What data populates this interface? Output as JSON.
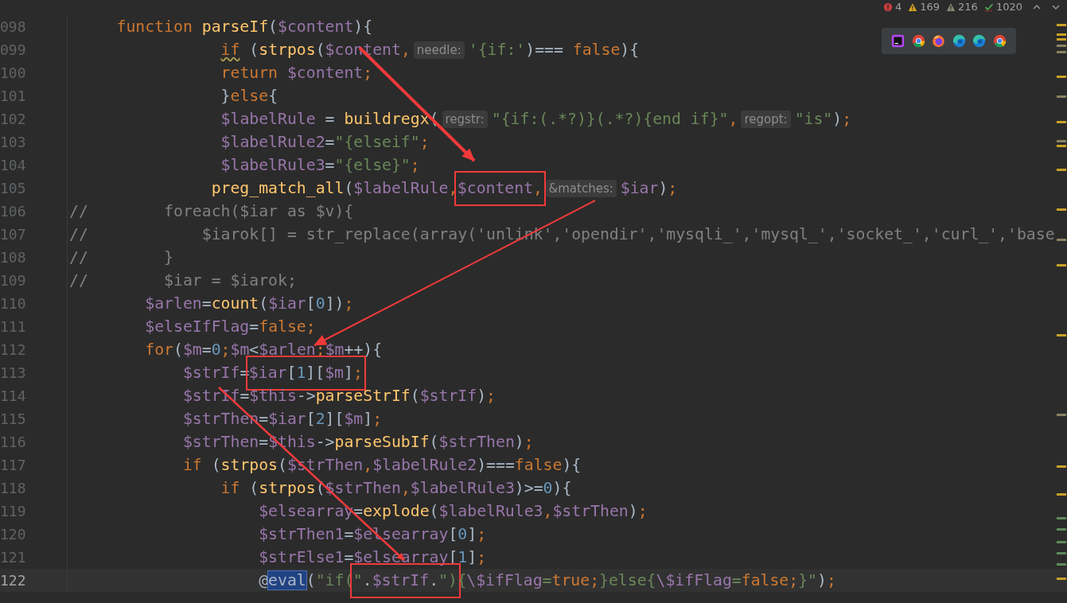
{
  "inspections": [
    {
      "kind": "error",
      "count": "4"
    },
    {
      "kind": "warning",
      "count": "169"
    },
    {
      "kind": "weak",
      "count": "216"
    },
    {
      "kind": "typo",
      "count": "1020"
    }
  ],
  "browsers": [
    {
      "kind": "ide"
    },
    {
      "kind": "chrome"
    },
    {
      "kind": "firefox"
    },
    {
      "kind": "edge"
    },
    {
      "kind": "edge"
    },
    {
      "kind": "chrome"
    }
  ],
  "lines": [
    {
      "number": "098",
      "current": false,
      "tokens": [
        {
          "kind": "k",
          "text": "     function "
        },
        {
          "kind": "f",
          "text": "parseIf"
        },
        {
          "kind": "t",
          "text": "("
        },
        {
          "kind": "v",
          "text": "$content"
        },
        {
          "kind": "t",
          "text": "){"
        }
      ]
    },
    {
      "number": "099",
      "current": false,
      "tokens": [
        {
          "kind": "w",
          "text": "                if"
        },
        {
          "kind": "t",
          "text": " ("
        },
        {
          "kind": "f",
          "text": "strpos"
        },
        {
          "kind": "t",
          "text": "("
        },
        {
          "kind": "v",
          "text": "$content"
        },
        {
          "kind": "k",
          "text": ","
        },
        {
          "kind": "h",
          "text": "needle:"
        },
        {
          "kind": "s",
          "text": "'{if:'"
        },
        {
          "kind": "t",
          "text": ")=== "
        },
        {
          "kind": "k",
          "text": "false"
        },
        {
          "kind": "t",
          "text": "){"
        }
      ]
    },
    {
      "number": "100",
      "current": false,
      "tokens": [
        {
          "kind": "k",
          "text": "                return "
        },
        {
          "kind": "v",
          "text": "$content"
        },
        {
          "kind": "k",
          "text": ";"
        }
      ]
    },
    {
      "number": "101",
      "current": false,
      "tokens": [
        {
          "kind": "t",
          "text": "                }"
        },
        {
          "kind": "k",
          "text": "else"
        },
        {
          "kind": "t",
          "text": "{"
        }
      ]
    },
    {
      "number": "102",
      "current": false,
      "tokens": [
        {
          "kind": "v",
          "text": "                $labelRule"
        },
        {
          "kind": "t",
          "text": " = "
        },
        {
          "kind": "f",
          "text": "buildregx"
        },
        {
          "kind": "t",
          "text": "("
        },
        {
          "kind": "h",
          "text": "regstr:"
        },
        {
          "kind": "s",
          "text": "\"{if:(.*?)}(.*?){end if}\""
        },
        {
          "kind": "k",
          "text": ","
        },
        {
          "kind": "h",
          "text": "regopt:"
        },
        {
          "kind": "s",
          "text": "\"is\""
        },
        {
          "kind": "t",
          "text": ")"
        },
        {
          "kind": "k",
          "text": ";"
        }
      ]
    },
    {
      "number": "103",
      "current": false,
      "tokens": [
        {
          "kind": "v",
          "text": "                $labelRule2"
        },
        {
          "kind": "t",
          "text": "="
        },
        {
          "kind": "s",
          "text": "\"{elseif\""
        },
        {
          "kind": "k",
          "text": ";"
        }
      ]
    },
    {
      "number": "104",
      "current": false,
      "tokens": [
        {
          "kind": "v",
          "text": "                $labelRule3"
        },
        {
          "kind": "t",
          "text": "="
        },
        {
          "kind": "s",
          "text": "\"{else}\""
        },
        {
          "kind": "k",
          "text": ";"
        }
      ]
    },
    {
      "number": "105",
      "current": false,
      "tokens": [
        {
          "kind": "f",
          "text": "               preg_match_all"
        },
        {
          "kind": "t",
          "text": "("
        },
        {
          "kind": "v",
          "text": "$labelRule"
        },
        {
          "kind": "k",
          "text": ","
        },
        {
          "kind": "box",
          "tokens": [
            {
              "kind": "v",
              "text": "$content"
            },
            {
              "kind": "k",
              "text": ","
            }
          ]
        },
        {
          "kind": "h",
          "text": "&matches:"
        },
        {
          "kind": "v",
          "text": "$iar"
        },
        {
          "kind": "t",
          "text": ")"
        },
        {
          "kind": "k",
          "text": ";"
        }
      ]
    },
    {
      "number": "106",
      "current": false,
      "tokens": [
        {
          "kind": "c",
          "text": "//        foreach($iar as $v){"
        }
      ]
    },
    {
      "number": "107",
      "current": false,
      "tokens": [
        {
          "kind": "c",
          "text": "//            $iarok[] = str_replace(array('unlink','opendir','mysqli_','mysql_','socket_','curl_','base"
        }
      ]
    },
    {
      "number": "108",
      "current": false,
      "tokens": [
        {
          "kind": "c",
          "text": "//        }"
        }
      ]
    },
    {
      "number": "109",
      "current": false,
      "tokens": [
        {
          "kind": "c",
          "text": "//        $iar = $iarok;"
        }
      ]
    },
    {
      "number": "110",
      "current": false,
      "tokens": [
        {
          "kind": "v",
          "text": "        $arlen"
        },
        {
          "kind": "t",
          "text": "="
        },
        {
          "kind": "f",
          "text": "count"
        },
        {
          "kind": "t",
          "text": "("
        },
        {
          "kind": "v",
          "text": "$iar"
        },
        {
          "kind": "t",
          "text": "["
        },
        {
          "kind": "n",
          "text": "0"
        },
        {
          "kind": "t",
          "text": "])"
        },
        {
          "kind": "k",
          "text": ";"
        }
      ]
    },
    {
      "number": "111",
      "current": false,
      "tokens": [
        {
          "kind": "v",
          "text": "        $elseIfFlag"
        },
        {
          "kind": "t",
          "text": "="
        },
        {
          "kind": "k",
          "text": "false;"
        }
      ]
    },
    {
      "number": "112",
      "current": false,
      "tokens": [
        {
          "kind": "k",
          "text": "        for"
        },
        {
          "kind": "t",
          "text": "("
        },
        {
          "kind": "v",
          "text": "$m"
        },
        {
          "kind": "t",
          "text": "="
        },
        {
          "kind": "n",
          "text": "0"
        },
        {
          "kind": "k",
          "text": ";"
        },
        {
          "kind": "v",
          "text": "$m"
        },
        {
          "kind": "t",
          "text": "<"
        },
        {
          "kind": "v",
          "text": "$arlen"
        },
        {
          "kind": "k",
          "text": ";"
        },
        {
          "kind": "v",
          "text": "$m"
        },
        {
          "kind": "t",
          "text": "++){"
        }
      ]
    },
    {
      "number": "113",
      "current": false,
      "tokens": [
        {
          "kind": "v",
          "text": "            $strIf"
        },
        {
          "kind": "t",
          "text": "="
        },
        {
          "kind": "box",
          "tokens": [
            {
              "kind": "v",
              "text": "$iar"
            },
            {
              "kind": "t",
              "text": "["
            },
            {
              "kind": "n",
              "text": "1"
            },
            {
              "kind": "t",
              "text": "]["
            },
            {
              "kind": "v",
              "text": "$m"
            },
            {
              "kind": "t",
              "text": "]"
            },
            {
              "kind": "k",
              "text": ";"
            }
          ]
        }
      ]
    },
    {
      "number": "114",
      "current": false,
      "tokens": [
        {
          "kind": "v",
          "text": "            $strIf"
        },
        {
          "kind": "t",
          "text": "="
        },
        {
          "kind": "v",
          "text": "$this"
        },
        {
          "kind": "t",
          "text": "->"
        },
        {
          "kind": "f",
          "text": "parseStrIf"
        },
        {
          "kind": "t",
          "text": "("
        },
        {
          "kind": "v",
          "text": "$strIf"
        },
        {
          "kind": "t",
          "text": ")"
        },
        {
          "kind": "k",
          "text": ";"
        }
      ]
    },
    {
      "number": "115",
      "current": false,
      "tokens": [
        {
          "kind": "v",
          "text": "            $strThen"
        },
        {
          "kind": "t",
          "text": "="
        },
        {
          "kind": "v",
          "text": "$iar"
        },
        {
          "kind": "t",
          "text": "["
        },
        {
          "kind": "n",
          "text": "2"
        },
        {
          "kind": "t",
          "text": "]["
        },
        {
          "kind": "v",
          "text": "$m"
        },
        {
          "kind": "t",
          "text": "]"
        },
        {
          "kind": "k",
          "text": ";"
        }
      ]
    },
    {
      "number": "116",
      "current": false,
      "tokens": [
        {
          "kind": "v",
          "text": "            $strThen"
        },
        {
          "kind": "t",
          "text": "="
        },
        {
          "kind": "v",
          "text": "$this"
        },
        {
          "kind": "t",
          "text": "->"
        },
        {
          "kind": "f",
          "text": "parseSubIf"
        },
        {
          "kind": "t",
          "text": "("
        },
        {
          "kind": "v",
          "text": "$strThen"
        },
        {
          "kind": "t",
          "text": ")"
        },
        {
          "kind": "k",
          "text": ";"
        }
      ]
    },
    {
      "number": "117",
      "current": false,
      "tokens": [
        {
          "kind": "k",
          "text": "            if "
        },
        {
          "kind": "t",
          "text": "("
        },
        {
          "kind": "f",
          "text": "strpos"
        },
        {
          "kind": "t",
          "text": "("
        },
        {
          "kind": "v",
          "text": "$strThen"
        },
        {
          "kind": "k",
          "text": ","
        },
        {
          "kind": "v",
          "text": "$labelRule2"
        },
        {
          "kind": "t",
          "text": ")==="
        },
        {
          "kind": "k",
          "text": "false"
        },
        {
          "kind": "t",
          "text": "){"
        }
      ]
    },
    {
      "number": "118",
      "current": false,
      "tokens": [
        {
          "kind": "k",
          "text": "                if "
        },
        {
          "kind": "t",
          "text": "("
        },
        {
          "kind": "f",
          "text": "strpos"
        },
        {
          "kind": "t",
          "text": "("
        },
        {
          "kind": "v",
          "text": "$strThen"
        },
        {
          "kind": "k",
          "text": ","
        },
        {
          "kind": "v",
          "text": "$labelRule3"
        },
        {
          "kind": "t",
          "text": ")>="
        },
        {
          "kind": "n",
          "text": "0"
        },
        {
          "kind": "t",
          "text": "){"
        }
      ]
    },
    {
      "number": "119",
      "current": false,
      "tokens": [
        {
          "kind": "v",
          "text": "                    $elsearray"
        },
        {
          "kind": "t",
          "text": "="
        },
        {
          "kind": "f",
          "text": "explode"
        },
        {
          "kind": "t",
          "text": "("
        },
        {
          "kind": "v",
          "text": "$labelRule3"
        },
        {
          "kind": "k",
          "text": ","
        },
        {
          "kind": "v",
          "text": "$strThen"
        },
        {
          "kind": "t",
          "text": ")"
        },
        {
          "kind": "k",
          "text": ";"
        }
      ]
    },
    {
      "number": "120",
      "current": false,
      "tokens": [
        {
          "kind": "v",
          "text": "                    $strThen1"
        },
        {
          "kind": "t",
          "text": "="
        },
        {
          "kind": "v",
          "text": "$elsearray"
        },
        {
          "kind": "t",
          "text": "["
        },
        {
          "kind": "n",
          "text": "0"
        },
        {
          "kind": "t",
          "text": "]"
        },
        {
          "kind": "k",
          "text": ";"
        }
      ]
    },
    {
      "number": "121",
      "current": false,
      "tokens": [
        {
          "kind": "v",
          "text": "                    $strElse1"
        },
        {
          "kind": "t",
          "text": "="
        },
        {
          "kind": "v",
          "text": "$elsearray"
        },
        {
          "kind": "t",
          "text": "["
        },
        {
          "kind": "n",
          "text": "1"
        },
        {
          "kind": "t",
          "text": "]"
        },
        {
          "kind": "k",
          "text": ";"
        }
      ]
    },
    {
      "number": "122",
      "current": true,
      "tokens": [
        {
          "kind": "t",
          "text": "                    @"
        },
        {
          "kind": "e",
          "text": "eval"
        },
        {
          "kind": "t",
          "text": "("
        },
        {
          "kind": "s",
          "text": "\"if("
        },
        {
          "kind": "box",
          "tokens": [
            {
              "kind": "s",
              "text": "\""
            },
            {
              "kind": "t",
              "text": "."
            },
            {
              "kind": "v",
              "text": "$strIf"
            },
            {
              "kind": "t",
              "text": "."
            },
            {
              "kind": "s",
              "text": "\")"
            }
          ]
        },
        {
          "kind": "s",
          "text": "{"
        },
        {
          "kind": "v",
          "text": "\\$ifFlag"
        },
        {
          "kind": "s",
          "text": "="
        },
        {
          "kind": "k",
          "text": "true;"
        },
        {
          "kind": "s",
          "text": "}else{"
        },
        {
          "kind": "v",
          "text": "\\$ifFlag"
        },
        {
          "kind": "s",
          "text": "="
        },
        {
          "kind": "k",
          "text": "false;"
        },
        {
          "kind": "s",
          "text": "}\""
        },
        {
          "kind": "t",
          "text": ")"
        },
        {
          "kind": "k",
          "text": ";"
        }
      ]
    }
  ]
}
